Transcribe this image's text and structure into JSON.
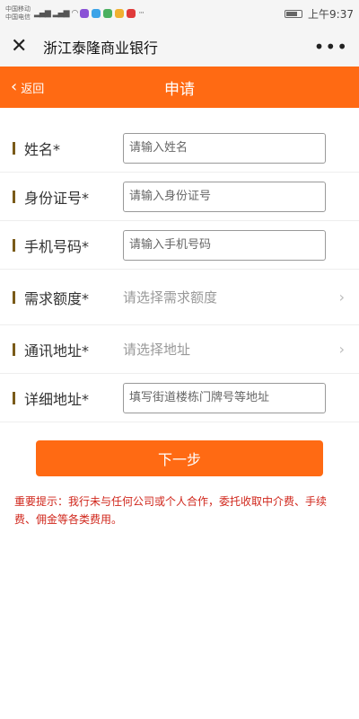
{
  "status_bar": {
    "carrier1": "中国移动",
    "carrier2": "中国电信",
    "time": "上午9:37",
    "battery_percent": 80
  },
  "title_bar": {
    "title": "浙江泰隆商业银行",
    "close_icon": "close-icon",
    "more_icon": "more-icon"
  },
  "header": {
    "back_label": "返回",
    "title": "申请"
  },
  "form": {
    "name": {
      "label": "姓名*",
      "placeholder": "请输入姓名"
    },
    "id_number": {
      "label": "身份证号*",
      "placeholder": "请输入身份证号"
    },
    "phone": {
      "label": "手机号码*",
      "placeholder": "请输入手机号码"
    },
    "amount": {
      "label": "需求额度*",
      "value": "请选择需求额度"
    },
    "address": {
      "label": "通讯地址*",
      "value": "请选择地址"
    },
    "detail_address": {
      "label": "详细地址*",
      "placeholder": "填写街道楼栋门牌号等地址"
    }
  },
  "next_button": "下一步",
  "notice": "重要提示：我行未与任何公司或个人合作，委托收取中介费、手续费、佣金等各类费用。",
  "colors": {
    "accent": "#ff6a13",
    "notice": "#d0261b",
    "label_bar": "#7a5b19"
  }
}
